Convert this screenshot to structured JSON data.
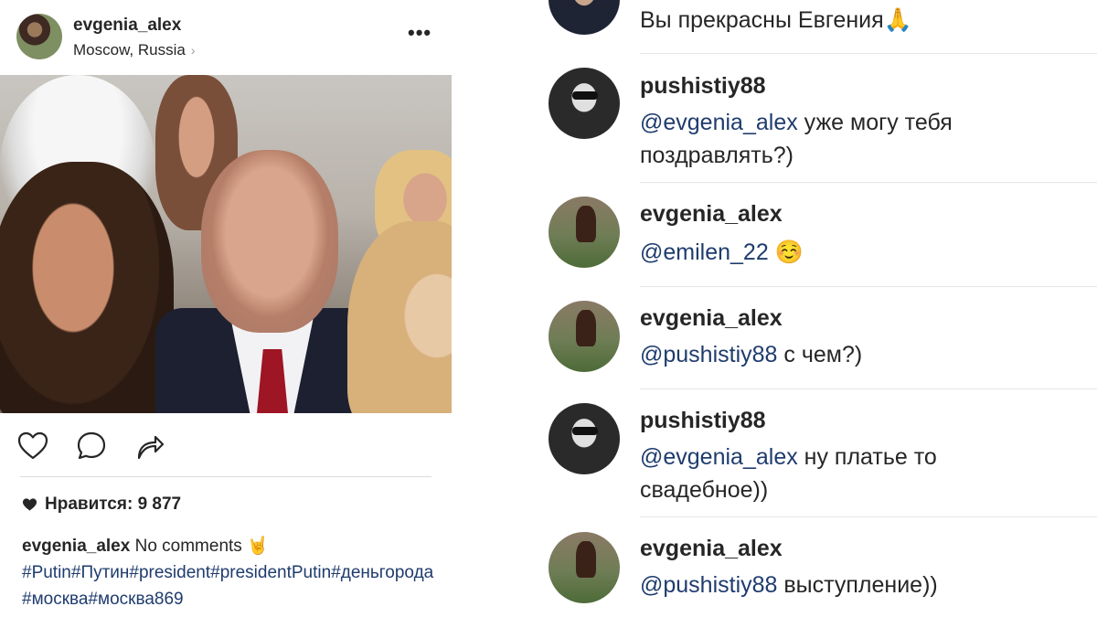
{
  "post": {
    "username": "evgenia_alex",
    "location": "Moscow, Russia",
    "likes_label": "Нравится: 9 877",
    "caption_user": "evgenia_alex",
    "caption_text": "No comments",
    "caption_emoji": "🤘",
    "hashtags": "#Putin#Путин#president#presidentPutin#деньгорода#москва#москва869"
  },
  "comments": [
    {
      "user": "",
      "mention": "",
      "text": "Вы прекрасны Евгения",
      "emoji": "🙏",
      "avatar": "man-suit-avatar"
    },
    {
      "user": "pushistiy88",
      "mention": "@evgenia_alex",
      "text": " уже могу тебя поздравлять?)",
      "emoji": "",
      "avatar": "pushistiy88-avatar"
    },
    {
      "user": "evgenia_alex",
      "mention": "@emilen_22",
      "text": " ",
      "emoji": "☺️",
      "avatar": "evgenia-avatar"
    },
    {
      "user": "evgenia_alex",
      "mention": "@pushistiy88",
      "text": " с чем?)",
      "emoji": "",
      "avatar": "evgenia-avatar"
    },
    {
      "user": "pushistiy88",
      "mention": "@evgenia_alex",
      "text": " ну платье то свадебное))",
      "emoji": "",
      "avatar": "pushistiy88-avatar"
    },
    {
      "user": "evgenia_alex",
      "mention": "@pushistiy88",
      "text": " выступление))",
      "emoji": "",
      "avatar": "evgenia-avatar"
    }
  ],
  "colors": {
    "link": "#1f3c6e",
    "text": "#262626",
    "divider": "#dbdbdb"
  }
}
